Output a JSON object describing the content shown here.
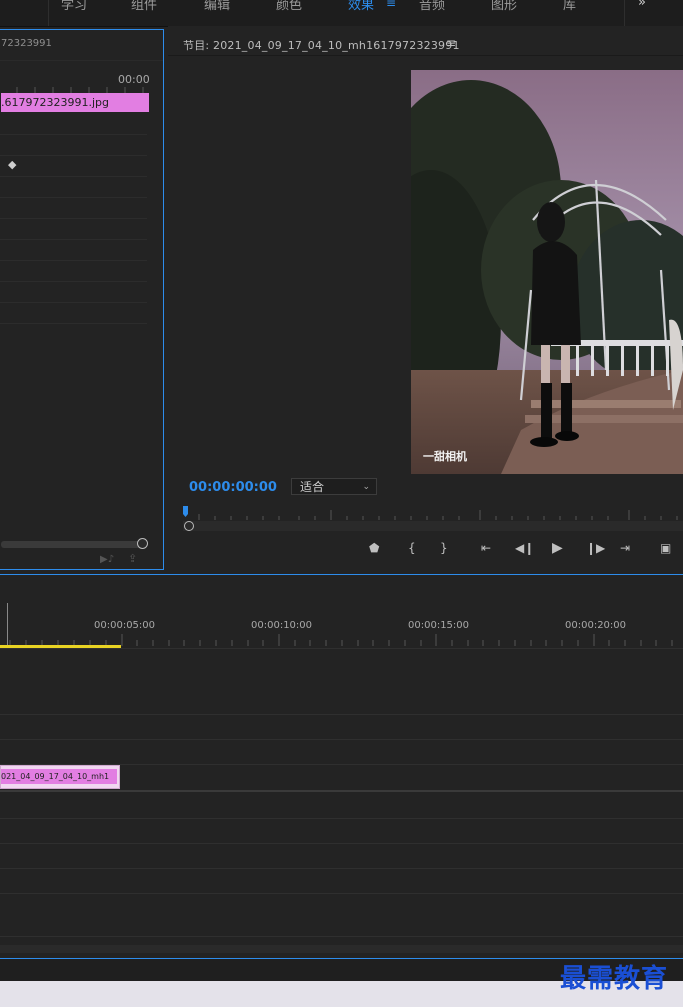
{
  "workspaces": {
    "learn": "学习",
    "assembly": "组件",
    "editing": "编辑",
    "color": "颜色",
    "effects": "效果",
    "audio": "音频",
    "graphics": "图形",
    "libraries": "库"
  },
  "effect_controls": {
    "source_partial": "72323991",
    "time_label": "00:00",
    "clip_label": ".617972323991.jpg"
  },
  "program_monitor": {
    "title": "节目: 2021_04_09_17_04_10_mh1617972323991",
    "timecode": "00:00:00:00",
    "fit": "适合",
    "watermark": "一甜相机"
  },
  "timeline": {
    "times": [
      "00:00:05:00",
      "00:00:10:00",
      "00:00:15:00",
      "00:00:20:00"
    ],
    "clip_label": "021_04_09_17_04_10_mh1"
  },
  "watermark": "最需教育",
  "colors": {
    "accent": "#2d8ceb",
    "clip": "#e27ee2"
  }
}
